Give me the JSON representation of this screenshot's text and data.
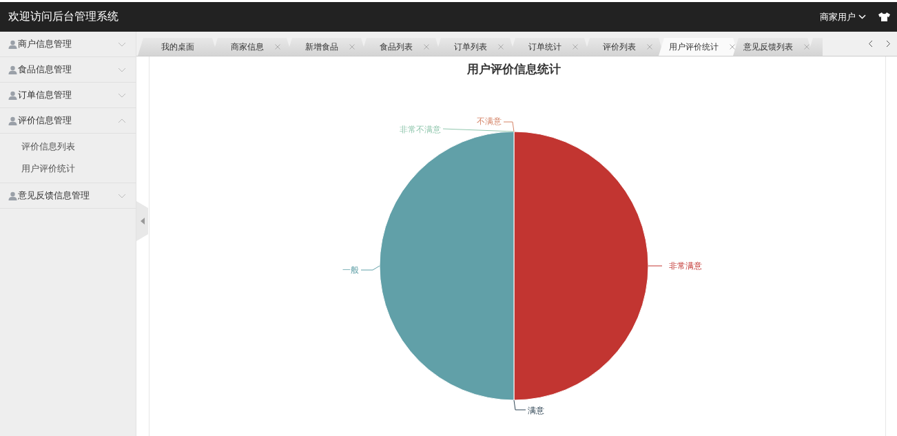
{
  "header": {
    "title": "欢迎访问后台管理系统",
    "user": "商家用户"
  },
  "sidebar": {
    "items": [
      {
        "label": "商户信息管理",
        "expanded": false
      },
      {
        "label": "食品信息管理",
        "expanded": false
      },
      {
        "label": "订单信息管理",
        "expanded": false
      },
      {
        "label": "评价信息管理",
        "expanded": true,
        "children": [
          {
            "label": "评价信息列表"
          },
          {
            "label": "用户评价统计"
          }
        ]
      },
      {
        "label": "意见反馈信息管理",
        "expanded": false
      }
    ]
  },
  "tabs": [
    {
      "label": "我的桌面",
      "selected": false,
      "closable": false
    },
    {
      "label": "商家信息",
      "selected": false,
      "closable": true
    },
    {
      "label": "新增食品",
      "selected": false,
      "closable": true
    },
    {
      "label": "食品列表",
      "selected": false,
      "closable": true
    },
    {
      "label": "订单列表",
      "selected": false,
      "closable": true
    },
    {
      "label": "订单统计",
      "selected": false,
      "closable": true
    },
    {
      "label": "评价列表",
      "selected": false,
      "closable": true
    },
    {
      "label": "用户评价统计",
      "selected": true,
      "closable": true
    },
    {
      "label": "意见反馈列表",
      "selected": false,
      "closable": true
    }
  ],
  "chart": {
    "chart_data": {
      "type": "pie",
      "title": "用户评价信息统计",
      "categories": [
        "非常满意",
        "满意",
        "一般",
        "非常不满意",
        "不满意"
      ],
      "values": [
        50,
        0,
        50,
        0,
        0
      ],
      "colors": [
        "#c23531",
        "#2f4554",
        "#61a0a8",
        "#91c7ae",
        "#d48265"
      ]
    }
  }
}
